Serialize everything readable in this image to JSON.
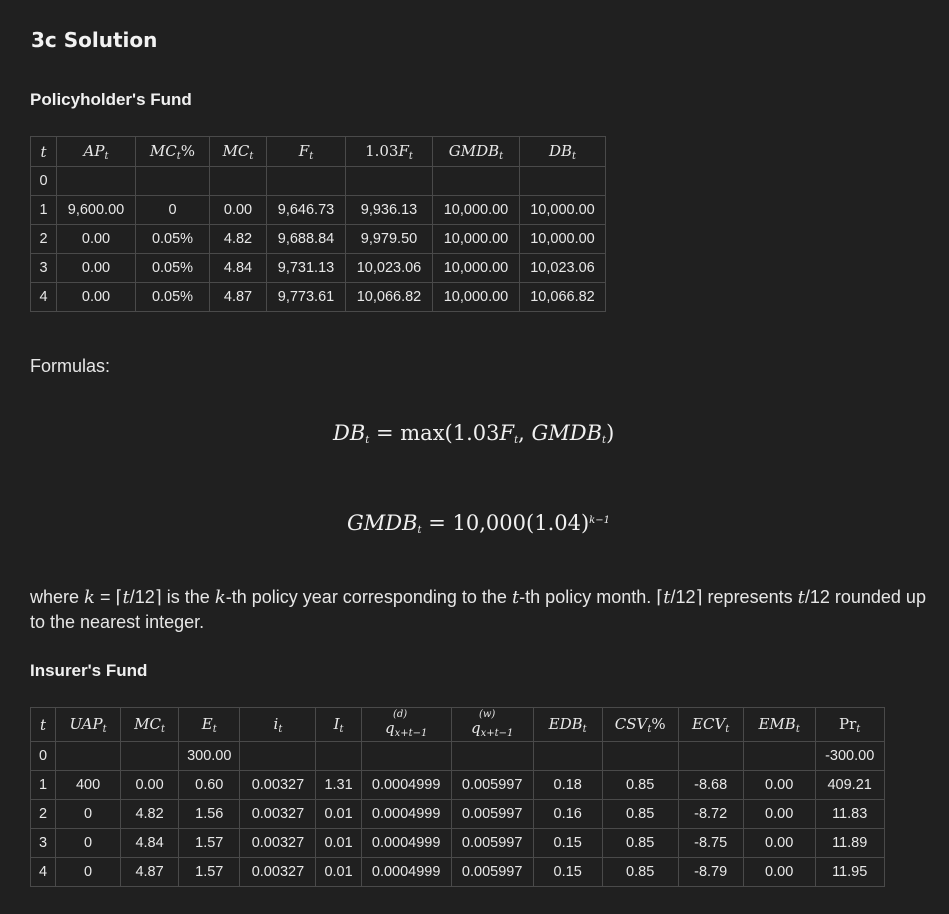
{
  "title": "3c Solution",
  "policyholder": {
    "heading": "Policyholder's Fund",
    "rows": [
      [
        "0",
        "",
        "",
        "",
        "",
        "",
        "",
        ""
      ],
      [
        "1",
        "9,600.00",
        "0",
        "0.00",
        "9,646.73",
        "9,936.13",
        "10,000.00",
        "10,000.00"
      ],
      [
        "2",
        "0.00",
        "0.05%",
        "4.82",
        "9,688.84",
        "9,979.50",
        "10,000.00",
        "10,000.00"
      ],
      [
        "3",
        "0.00",
        "0.05%",
        "4.84",
        "9,731.13",
        "10,023.06",
        "10,000.00",
        "10,023.06"
      ],
      [
        "4",
        "0.00",
        "0.05%",
        "4.87",
        "9,773.61",
        "10,066.82",
        "10,000.00",
        "10,066.82"
      ]
    ]
  },
  "formulas_label": "Formulas:",
  "eq2_number": "10,000",
  "explanation": {
    "part1": "where",
    "part2": "is the",
    "part3": "-th policy year corresponding to the",
    "part4": "-th policy month.",
    "part5": "represents",
    "part6": "rounded up to the nearest integer."
  },
  "insurer": {
    "heading": "Insurer's Fund",
    "rows": [
      [
        "0",
        "",
        "",
        "300.00",
        "",
        "",
        "",
        "",
        "",
        "",
        "",
        "",
        "-300.00"
      ],
      [
        "1",
        "400",
        "0.00",
        "0.60",
        "0.00327",
        "1.31",
        "0.0004999",
        "0.005997",
        "0.18",
        "0.85",
        "-8.68",
        "0.00",
        "409.21"
      ],
      [
        "2",
        "0",
        "4.82",
        "1.56",
        "0.00327",
        "0.01",
        "0.0004999",
        "0.005997",
        "0.16",
        "0.85",
        "-8.72",
        "0.00",
        "11.83"
      ],
      [
        "3",
        "0",
        "4.84",
        "1.57",
        "0.00327",
        "0.01",
        "0.0004999",
        "0.005997",
        "0.15",
        "0.85",
        "-8.75",
        "0.00",
        "11.89"
      ],
      [
        "4",
        "0",
        "4.87",
        "1.57",
        "0.00327",
        "0.01",
        "0.0004999",
        "0.005997",
        "0.15",
        "0.85",
        "-8.79",
        "0.00",
        "11.95"
      ]
    ]
  }
}
